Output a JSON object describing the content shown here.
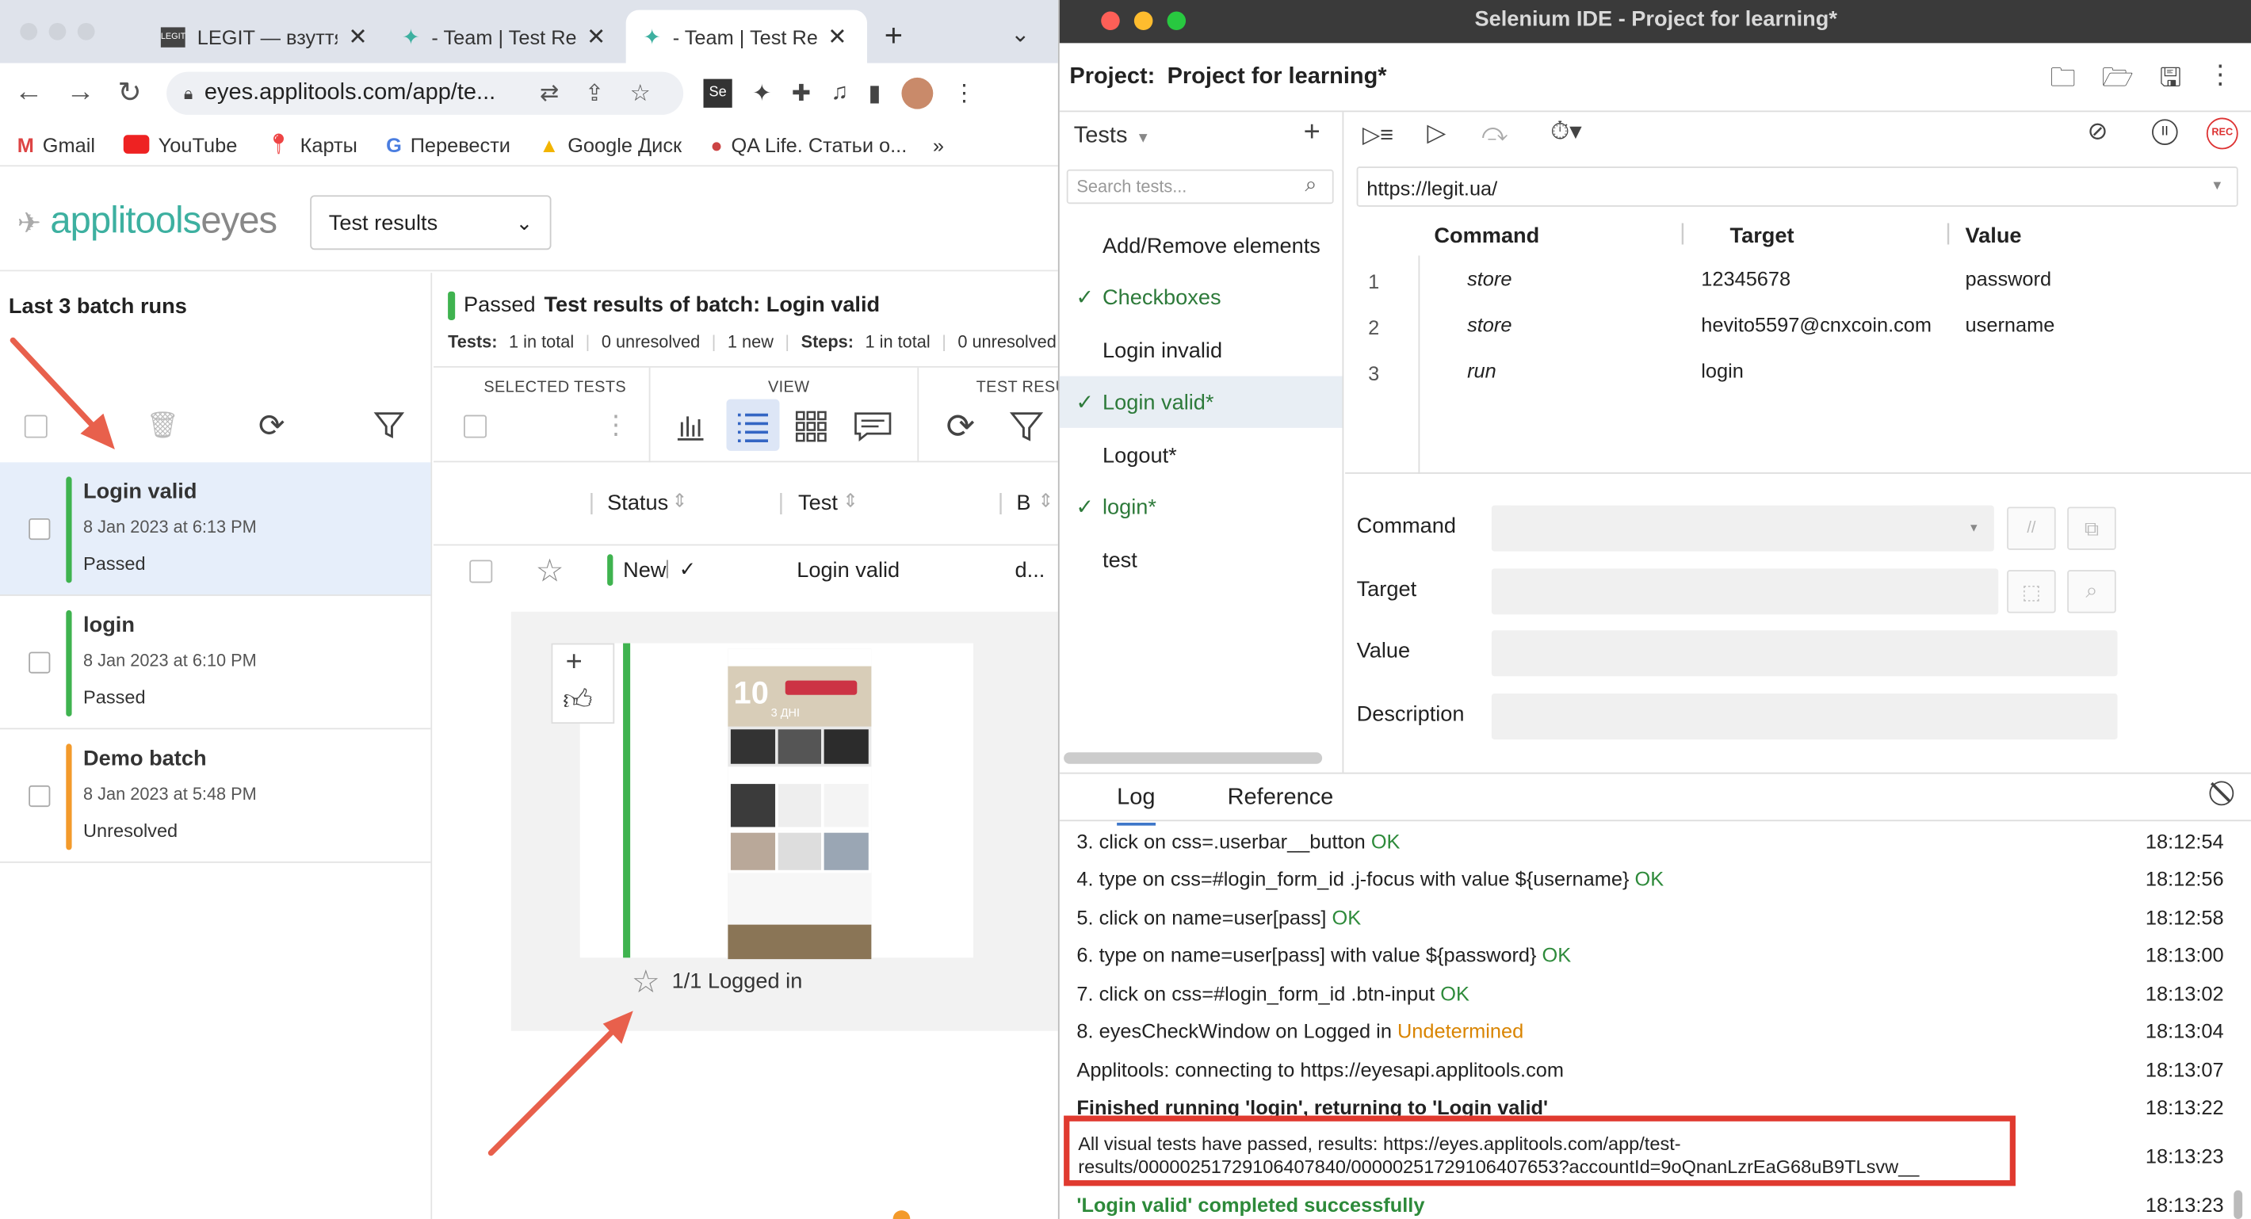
{
  "chrome": {
    "tabs": [
      {
        "title": "LEGIT — взуття"
      },
      {
        "title": "- Team | Test Re"
      },
      {
        "title": "- Team | Test Re"
      }
    ],
    "url": "eyes.applitools.com/app/te...",
    "bookmarks": [
      "Gmail",
      "YouTube",
      "Карты",
      "Перевести",
      "Google Диск",
      "QA Life. Статьи о..."
    ],
    "more": "»"
  },
  "applitools": {
    "logo_main": "applitools",
    "logo_sub": "eyes",
    "view_select": "Test results",
    "batch_list_title": "Last 3 batch runs",
    "batches": [
      {
        "name": "Login valid",
        "date": "8 Jan 2023 at 6:13 PM",
        "status": "Passed",
        "color": "#3fb34f"
      },
      {
        "name": "login",
        "date": "8 Jan 2023 at 6:10 PM",
        "status": "Passed",
        "color": "#3fb34f"
      },
      {
        "name": "Demo batch",
        "date": "8 Jan 2023 at 5:48 PM",
        "status": "Unresolved",
        "color": "#f39a2b"
      }
    ],
    "batch_status": "Passed",
    "batch_title": "Test results of batch:  Login valid",
    "tests_label": "Tests:",
    "tests_total": "1 in total",
    "tests_unresolved": "0 unresolved",
    "tests_new": "1 new",
    "steps_label": "Steps:",
    "steps_total": "1 in total",
    "steps_unresolved": "0 unresolved",
    "sections": {
      "selected": "SELECTED TESTS",
      "view": "VIEW",
      "results": "TEST RESU"
    },
    "columns": {
      "status": "Status",
      "test": "Test",
      "b": "B"
    },
    "row": {
      "status": "New",
      "test": "Login valid",
      "extra": "d..."
    },
    "step_caption": "1/1 Logged in"
  },
  "selenium": {
    "window_title": "Selenium IDE - Project for learning*",
    "project_label": "Project:",
    "project_name": "Project for learning*",
    "tests_header": "Tests",
    "search_placeholder": "Search tests...",
    "tests": [
      {
        "name": "Add/Remove elements",
        "check": ""
      },
      {
        "name": "Checkboxes",
        "check": "✓"
      },
      {
        "name": "Login invalid",
        "check": ""
      },
      {
        "name": "Login valid*",
        "check": "✓"
      },
      {
        "name": "Logout*",
        "check": ""
      },
      {
        "name": "login*",
        "check": "✓"
      },
      {
        "name": "test",
        "check": ""
      }
    ],
    "base_url": "https://legit.ua/",
    "columns": {
      "command": "Command",
      "target": "Target",
      "value": "Value"
    },
    "commands": [
      {
        "num": "1",
        "command": "store",
        "target": "12345678",
        "value": "password"
      },
      {
        "num": "2",
        "command": "store",
        "target": "hevito5597@cnxcoin.com",
        "value": "username"
      },
      {
        "num": "3",
        "command": "run",
        "target": "login",
        "value": ""
      }
    ],
    "editor": {
      "command": "Command",
      "target": "Target",
      "value": "Value",
      "description": "Description",
      "comment_btn": "//"
    },
    "rec": "REC",
    "log_tabs": {
      "log": "Log",
      "reference": "Reference"
    },
    "log": [
      {
        "text": "3.  click on css=.userbar__button ",
        "status": "OK",
        "kind": "ok",
        "time": "18:12:54"
      },
      {
        "text": "4.  type on css=#login_form_id .j-focus with value ${username} ",
        "status": "OK",
        "kind": "ok",
        "time": "18:12:56"
      },
      {
        "text": "5.  click on name=user[pass] ",
        "status": "OK",
        "kind": "ok",
        "time": "18:12:58"
      },
      {
        "text": "6.  type on name=user[pass] with value ${password} ",
        "status": "OK",
        "kind": "ok",
        "time": "18:13:00"
      },
      {
        "text": "7.  click on css=#login_form_id .btn-input ",
        "status": "OK",
        "kind": "ok",
        "time": "18:13:02"
      },
      {
        "text": "8.  eyesCheckWindow on Logged in ",
        "status": "Undetermined",
        "kind": "und",
        "time": "18:13:04"
      },
      {
        "text": "Applitools: connecting to https://eyesapi.applitools.com",
        "status": "",
        "kind": "",
        "time": "18:13:07"
      },
      {
        "text": "Finished running 'login', returning to 'Login valid'",
        "status": "",
        "kind": "",
        "time": "18:13:22"
      }
    ],
    "result_line1": "All visual tests have passed, results: https://eyes.applitools.com/app/test-",
    "result_line2": "results/00000251729106407840/00000251729106407653?accountId=9oQnanLzrEaG68uB9TLsvw__",
    "result_time": "18:13:23",
    "final_line": "'Login valid' completed successfully",
    "final_time": "18:13:23"
  },
  "colors": {
    "accent": "#3db0a0",
    "passed": "#3fb34f",
    "unresolved": "#f39a2b",
    "highlight": "#e03a2f",
    "arrow": "#e8604c"
  }
}
